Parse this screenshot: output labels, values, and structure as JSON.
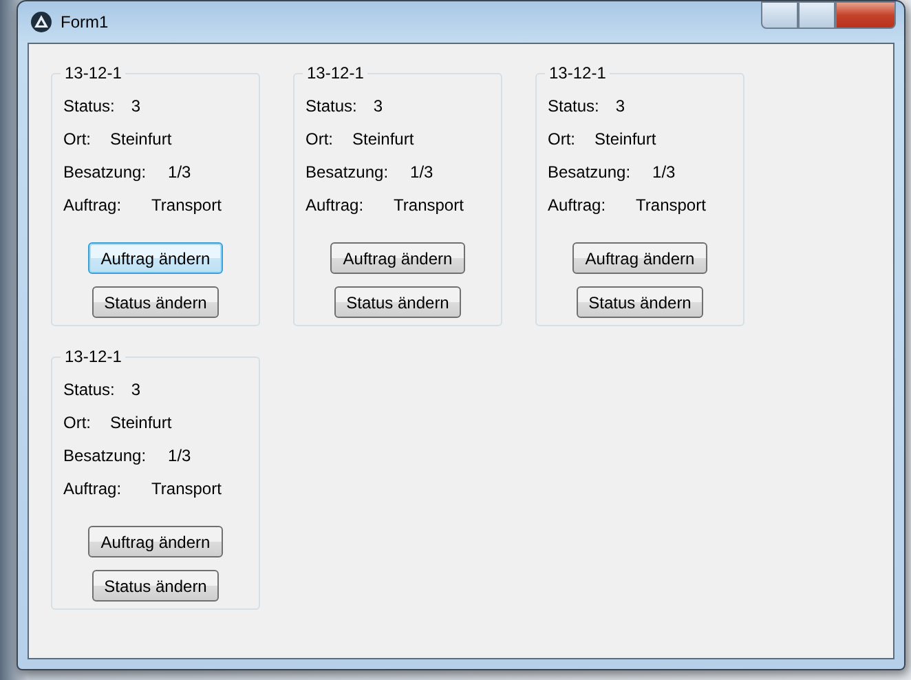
{
  "window": {
    "title": "Form1"
  },
  "groups": [
    {
      "title": "13-12-1",
      "fields": [
        {
          "label": "Status:",
          "value": "3"
        },
        {
          "label": "Ort:",
          "value": "Steinfurt"
        },
        {
          "label": "Besatzung:",
          "value": "1/3"
        },
        {
          "label": "Auftrag:",
          "value": "Transport"
        }
      ],
      "buttons": [
        {
          "label": "Auftrag ändern",
          "focused": true
        },
        {
          "label": "Status ändern",
          "focused": false
        }
      ]
    },
    {
      "title": "13-12-1",
      "fields": [
        {
          "label": "Status:",
          "value": "3"
        },
        {
          "label": "Ort:",
          "value": "Steinfurt"
        },
        {
          "label": "Besatzung:",
          "value": "1/3"
        },
        {
          "label": "Auftrag:",
          "value": "Transport"
        }
      ],
      "buttons": [
        {
          "label": "Auftrag ändern",
          "focused": false
        },
        {
          "label": "Status ändern",
          "focused": false
        }
      ]
    },
    {
      "title": "13-12-1",
      "fields": [
        {
          "label": "Status:",
          "value": "3"
        },
        {
          "label": "Ort:",
          "value": "Steinfurt"
        },
        {
          "label": "Besatzung:",
          "value": "1/3"
        },
        {
          "label": "Auftrag:",
          "value": "Transport"
        }
      ],
      "buttons": [
        {
          "label": "Auftrag ändern",
          "focused": false
        },
        {
          "label": "Status ändern",
          "focused": false
        }
      ]
    },
    {
      "title": "13-12-1",
      "fields": [
        {
          "label": "Status:",
          "value": "3"
        },
        {
          "label": "Ort:",
          "value": "Steinfurt"
        },
        {
          "label": "Besatzung:",
          "value": "1/3"
        },
        {
          "label": "Auftrag:",
          "value": "Transport"
        }
      ],
      "buttons": [
        {
          "label": "Auftrag ändern",
          "focused": false
        },
        {
          "label": "Status ändern",
          "focused": false
        }
      ]
    }
  ]
}
